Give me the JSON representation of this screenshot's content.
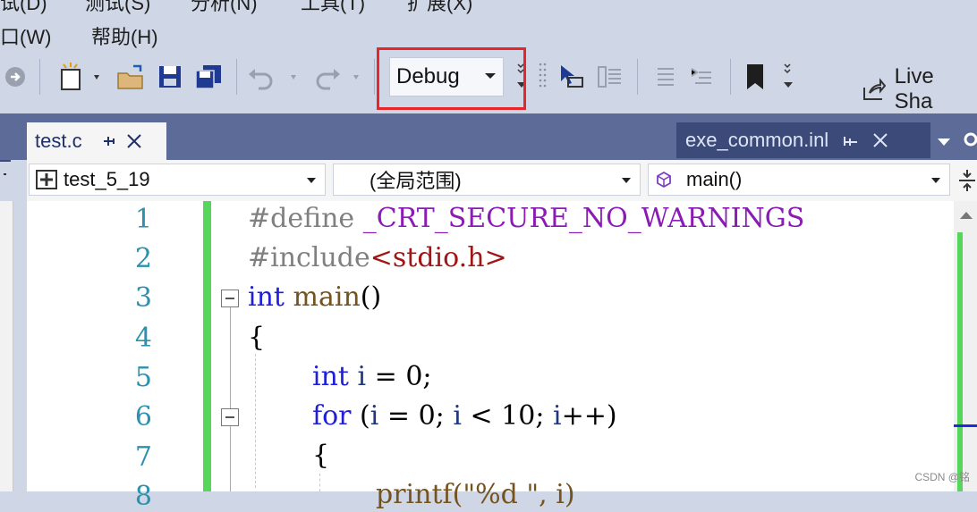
{
  "menu_top": [
    "试(D)",
    "测试(S)",
    "分析(N)",
    "工具(T)",
    "扩展(X)"
  ],
  "menu": {
    "window": "口(W)",
    "help": "帮助(H)"
  },
  "toolbar": {
    "config_value": "Debug",
    "live_share_label": "Live Sha",
    "icons": [
      "navigate-forward-icon",
      "new-project-icon",
      "open-folder-icon",
      "save-icon",
      "save-all-icon",
      "undo-icon",
      "redo-icon",
      "comment-icon",
      "uncomment-icon",
      "bookmark-icon"
    ]
  },
  "tabs": {
    "active": "test.c",
    "other": "exe_common.inl"
  },
  "navbar": {
    "project": "test_5_19",
    "scope": "(全局范围)",
    "member": "main()"
  },
  "editor": {
    "line_numbers": [
      "1",
      "2",
      "3",
      "4",
      "5",
      "6",
      "7",
      "8"
    ],
    "lines": {
      "l1_directive": "#define",
      "l1_macro": "_CRT_SECURE_NO_WARNINGS",
      "l2_directive": "#include",
      "l2_header": "<stdio.h>",
      "l3_kw": "int",
      "l3_fn": "main",
      "l3_rest": "()",
      "l4": "{",
      "l5_kw": "int",
      "l5_var": "i",
      "l5_rest": " = 0;",
      "l6_kw": "for",
      "l6_a": " (",
      "l6_i1": "i",
      "l6_b": " = 0; ",
      "l6_i2": "i",
      "l6_c": " < 10; ",
      "l6_i3": "i",
      "l6_d": "++)",
      "l7": "{",
      "l8_partial": "printf(\"%d \", i)"
    }
  },
  "watermark": "CSDN @铭"
}
